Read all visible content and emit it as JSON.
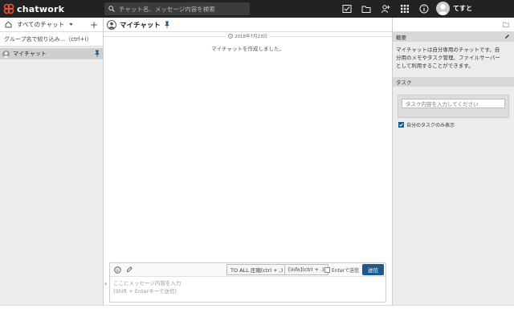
{
  "app": {
    "logo_text": "chatwork"
  },
  "search": {
    "placeholder": "チャット名、メッセージ内容を検索"
  },
  "user": {
    "name": "てすと"
  },
  "sidebar": {
    "header": "すべてのチャット",
    "filter_placeholder": "グループ名で絞り込み...（ctrl+i）",
    "rooms": [
      {
        "name": "マイチャット"
      }
    ]
  },
  "chat": {
    "title": "マイチャット",
    "date": "2018年7月23日",
    "system_message": "マイチャットを作成しました。"
  },
  "composer": {
    "to_all_label": "TO ALL 圧縮(ctrl + ,)",
    "info_label": "[info](ctrl + .)",
    "enter_label": "Enterで送信",
    "send_label": "送信",
    "placeholder_line1": "ここにメッセージ内容を入力",
    "placeholder_line2": "(Shift + Enterキーで送信)"
  },
  "right_panel": {
    "overview_title": "概要",
    "overview_line1": "マイチャットは自分専用のチャットです。自",
    "overview_line2": "分用のメモやタスク管理、ファイルサーバー",
    "overview_line3": "として利用することができます。",
    "task_title": "タスク",
    "task_placeholder": "タスク内容を入力してください",
    "only_mine_label": "自分のタスクのみ表示"
  },
  "colors": {
    "topbar": "#222222",
    "accent": "#1d5a8a",
    "logo_red": "#e5533d"
  }
}
